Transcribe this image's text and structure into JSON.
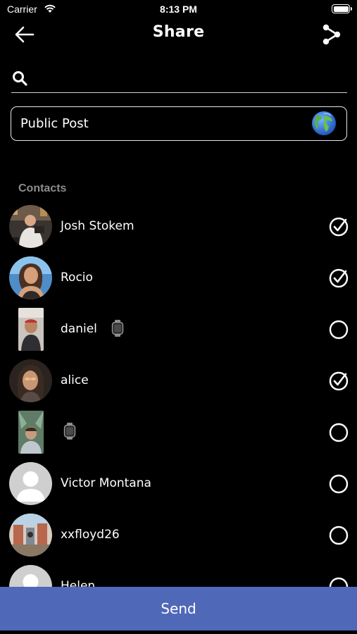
{
  "status_bar": {
    "carrier": "Carrier",
    "time": "8:13 PM"
  },
  "header": {
    "title": "Share",
    "back_icon": "arrow-left-icon",
    "share_icon": "share-nodes-icon"
  },
  "search": {
    "icon": "search-icon",
    "placeholder": "",
    "value": ""
  },
  "public_post": {
    "label": "Public Post",
    "icon": "globe-icon"
  },
  "contacts": {
    "heading": "Contacts",
    "items": [
      {
        "name": "Josh Stokem",
        "selected": true,
        "watch": false
      },
      {
        "name": "Rocio",
        "selected": true,
        "watch": false
      },
      {
        "name": "daniel",
        "selected": false,
        "watch": true
      },
      {
        "name": "alice",
        "selected": true,
        "watch": false
      },
      {
        "name": "",
        "selected": false,
        "watch": true
      },
      {
        "name": "Victor Montana",
        "selected": false,
        "watch": false
      },
      {
        "name": "xxfloyd26",
        "selected": false,
        "watch": false
      },
      {
        "name": "Helen",
        "selected": false,
        "watch": false
      }
    ]
  },
  "send": {
    "label": "Send"
  },
  "colors": {
    "background": "#000000",
    "send_bar": "#4f68b8",
    "text": "#ffffff",
    "muted": "#8c8c8c"
  }
}
